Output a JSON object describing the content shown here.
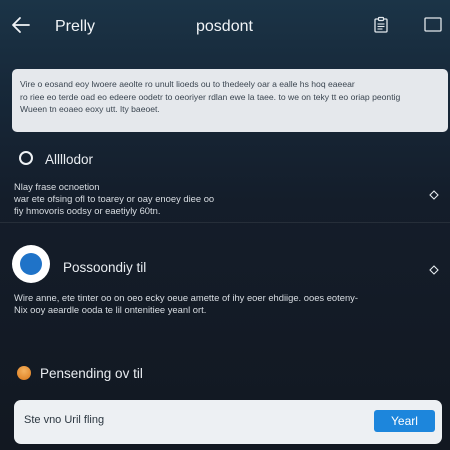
{
  "topbar": {
    "back_icon": "arrow-left-icon",
    "title": "Prelly",
    "center_title": "posdont",
    "right_icons": [
      "clipboard-icon",
      "window-icon"
    ]
  },
  "notice": {
    "lines": [
      "Vire o eosand eoy lwoere aeolte ro unult lioeds ou to thedeely oar a ealle hs hoq eaeear",
      "ro riee eo terde oad eo edeere oodetr to oeoriyer rdlan ewe la taee. to we on teky tt eo oriap peontig",
      "Wueen tn eoaeo eoxy utt. lty baeoet."
    ]
  },
  "options": [
    {
      "title": "Allllodor",
      "desc_lines": [
        "Nlay frase ocnoetion",
        "war ete ofsing ofl to toarey or oay enoey diee oo",
        "fiy hmovoris oodsy or eaetiyly 60tn."
      ],
      "state": "outline"
    },
    {
      "title": "Possoondiy til",
      "desc_lines": [
        "Wire anne, ete tinter oo on oeo ecky oeue amette of ihy eoer ehdiige. ooes eoteny-",
        "Nix ooy aeardle ooda te lil ontenitiee yeanl ort."
      ],
      "state": "selected"
    },
    {
      "title": "Pensending ov til",
      "state": "warning"
    }
  ],
  "input": {
    "value": "Ste vno Uril fling",
    "button_label": "Yearl"
  },
  "colors": {
    "accent": "#1d86dc",
    "selected_dot": "#1f73c8",
    "warning": "#e38a2f",
    "card_bg": "#e5e8ec"
  }
}
